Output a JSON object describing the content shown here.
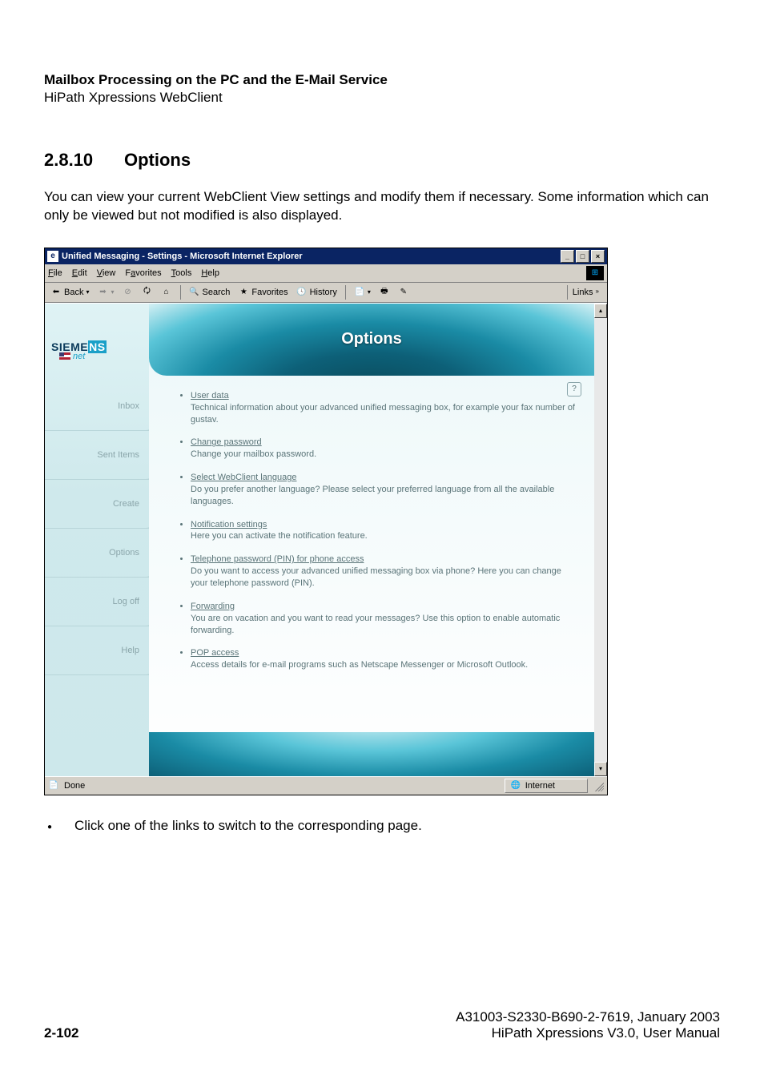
{
  "header": {
    "title": "Mailbox Processing on the PC and the E-Mail Service",
    "subtitle": "HiPath Xpressions WebClient"
  },
  "section": {
    "number": "2.8.10",
    "title": "Options"
  },
  "intro_text": "You can view your current WebClient View settings and modify them if necessary. Some information which can only be viewed but not modified is also displayed.",
  "window": {
    "title": "Unified Messaging - Settings - Microsoft Internet Explorer",
    "menus": {
      "file": "File",
      "edit": "Edit",
      "view": "View",
      "favorites": "Favorites",
      "tools": "Tools",
      "help": "Help"
    },
    "toolbar": {
      "back": "Back",
      "search": "Search",
      "favorites": "Favorites",
      "history": "History",
      "links": "Links"
    },
    "status": {
      "done": "Done",
      "zone": "Internet"
    }
  },
  "logo": {
    "brand": "SIEMENS",
    "tag": "net"
  },
  "banner_title": "Options",
  "nav": {
    "inbox": "Inbox",
    "sent": "Sent Items",
    "create": "Create",
    "options": "Options",
    "logoff": "Log off",
    "help": "Help"
  },
  "options_list": [
    {
      "link": "User data",
      "desc": "Technical information about your advanced unified messaging box, for example your fax number of gustav."
    },
    {
      "link": "Change password",
      "desc": "Change your mailbox password."
    },
    {
      "link": "Select WebClient language",
      "desc": "Do you prefer another language? Please select your preferred language from all the available languages."
    },
    {
      "link": "Notification settings",
      "desc": "Here you can activate the notification feature."
    },
    {
      "link": "Telephone password (PIN) for phone access",
      "desc": "Do you want to access your advanced unified messaging box via phone? Here you can change your telephone password (PIN)."
    },
    {
      "link": "Forwarding",
      "desc": "You are on vacation and you want to read your messages? Use this option to enable automatic forwarding."
    },
    {
      "link": "POP access",
      "desc": "Access details for e-mail programs such as Netscape Messenger or Microsoft Outlook."
    }
  ],
  "post_bullet": "Click one of the links to switch to the corresponding page.",
  "footer": {
    "docid": "A31003-S2330-B690-2-7619, January 2003",
    "manual": "HiPath Xpressions V3.0, User Manual",
    "page": "2-102"
  }
}
